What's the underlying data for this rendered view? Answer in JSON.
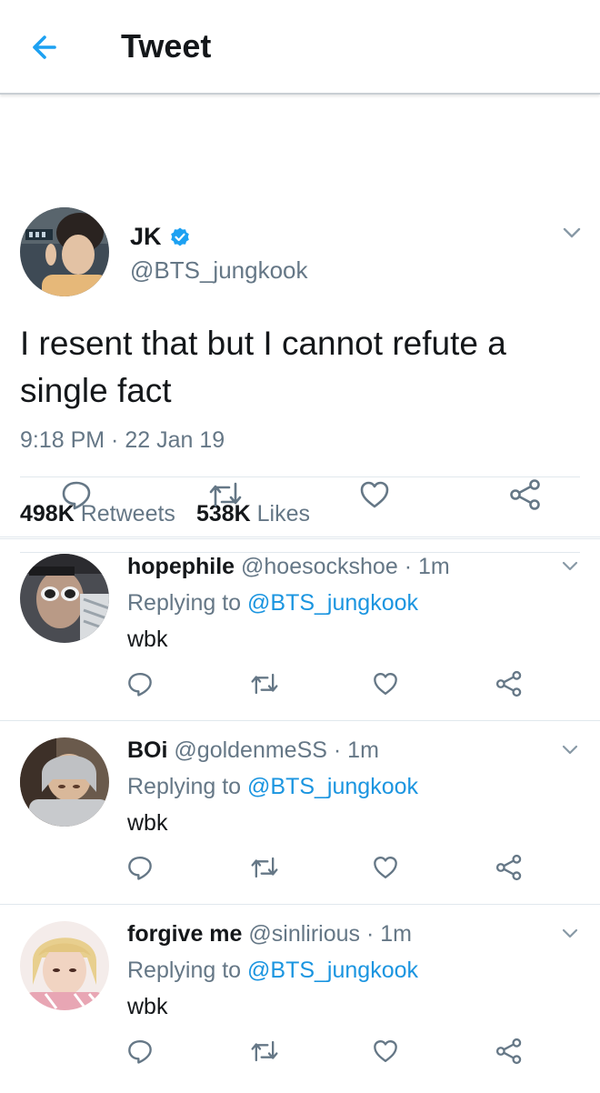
{
  "header": {
    "title": "Tweet",
    "back_icon": "arrow-left-icon",
    "accent_color": "#1da1f2"
  },
  "main_tweet": {
    "name": "JK",
    "verified": true,
    "handle": "@BTS_jungkook",
    "text": "I resent that but I cannot refute a single fact",
    "timestamp": "9:18 PM · 22 Jan 19",
    "retweets_count": "498K",
    "retweets_label": "Retweets",
    "likes_count": "538K",
    "likes_label": "Likes"
  },
  "replies": [
    {
      "name": "hopephile",
      "handle": "@hoesockshoe",
      "time": "1m",
      "replying_prefix": "Replying to",
      "replying_to": "@BTS_jungkook",
      "text": "wbk"
    },
    {
      "name": "BOi",
      "handle": "@goldenmeSS",
      "time": "1m",
      "replying_prefix": "Replying to",
      "replying_to": "@BTS_jungkook",
      "text": "wbk"
    },
    {
      "name": "forgive me",
      "handle": "@sinlirious",
      "time": "1m",
      "replying_prefix": "Replying to",
      "replying_to": "@BTS_jungkook",
      "text": "wbk"
    }
  ],
  "icons": {
    "reply": "comment-icon",
    "retweet": "retweet-icon",
    "like": "heart-icon",
    "share": "share-icon",
    "caret": "chevron-down-icon"
  },
  "colors": {
    "secondary_text": "#657786",
    "link": "#1b95e0",
    "icon_gray": "#657786",
    "verified": "#1da1f2"
  }
}
